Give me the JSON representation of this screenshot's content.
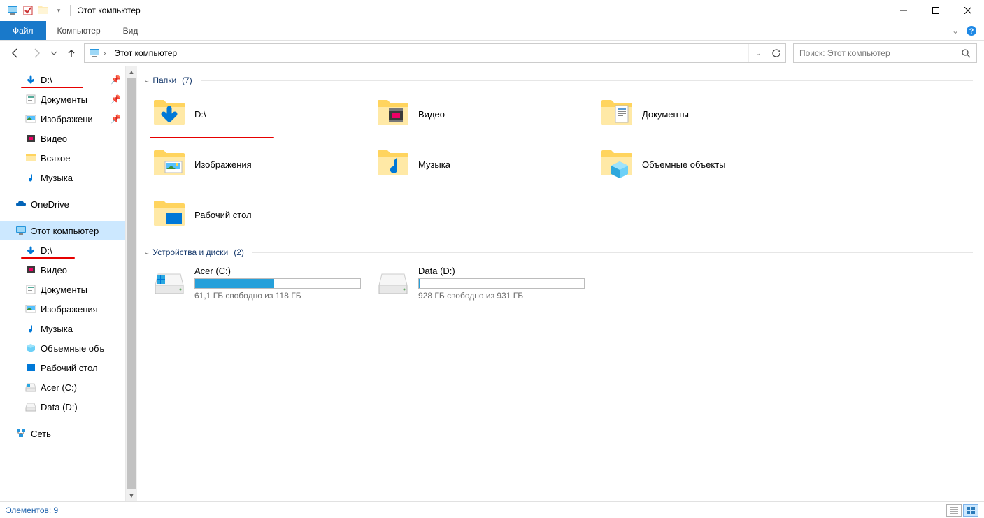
{
  "window": {
    "title": "Этот компьютер"
  },
  "ribbon": {
    "file": "Файл",
    "tabs": [
      "Компьютер",
      "Вид"
    ]
  },
  "address": {
    "location": "Этот компьютер"
  },
  "search": {
    "placeholder": "Поиск: Этот компьютер"
  },
  "tree": {
    "quick": [
      {
        "label": "D:\\",
        "icon": "downloads",
        "pinned": true,
        "annot": true
      },
      {
        "label": "Документы",
        "icon": "doc",
        "pinned": true
      },
      {
        "label": "Изображени",
        "icon": "pictures",
        "pinned": true
      },
      {
        "label": "Видео",
        "icon": "video"
      },
      {
        "label": "Всякое",
        "icon": "folder"
      },
      {
        "label": "Музыка",
        "icon": "music"
      }
    ],
    "onedrive": {
      "label": "OneDrive"
    },
    "thispc": {
      "label": "Этот компьютер",
      "children": [
        {
          "label": "D:\\",
          "icon": "downloads",
          "annot": true
        },
        {
          "label": "Видео",
          "icon": "video"
        },
        {
          "label": "Документы",
          "icon": "doc"
        },
        {
          "label": "Изображения",
          "icon": "pictures"
        },
        {
          "label": "Музыка",
          "icon": "music"
        },
        {
          "label": "Объемные объ",
          "icon": "objects3d"
        },
        {
          "label": "Рабочий стол",
          "icon": "desktop"
        },
        {
          "label": "Acer (C:)",
          "icon": "osdrive"
        },
        {
          "label": "Data (D:)",
          "icon": "hdd"
        }
      ]
    },
    "network": {
      "label": "Сеть"
    }
  },
  "groups": {
    "folders": {
      "title": "Папки",
      "count": "(7)",
      "items": [
        {
          "label": "D:\\",
          "icon": "downloads",
          "annot": true
        },
        {
          "label": "Видео",
          "icon": "video"
        },
        {
          "label": "Документы",
          "icon": "doc"
        },
        {
          "label": "Изображения",
          "icon": "pictures"
        },
        {
          "label": "Музыка",
          "icon": "music"
        },
        {
          "label": "Объемные объекты",
          "icon": "objects3d"
        },
        {
          "label": "Рабочий стол",
          "icon": "desktop"
        }
      ]
    },
    "drives": {
      "title": "Устройства и диски",
      "count": "(2)",
      "items": [
        {
          "label": "Acer (C:)",
          "free": "61,1 ГБ свободно из 118 ГБ",
          "fill_pct": 48,
          "icon": "osdrive"
        },
        {
          "label": "Data (D:)",
          "free": "928 ГБ свободно из 931 ГБ",
          "fill_pct": 1,
          "icon": "hdd"
        }
      ]
    }
  },
  "status": {
    "items_label": "Элементов:",
    "count": "9"
  }
}
